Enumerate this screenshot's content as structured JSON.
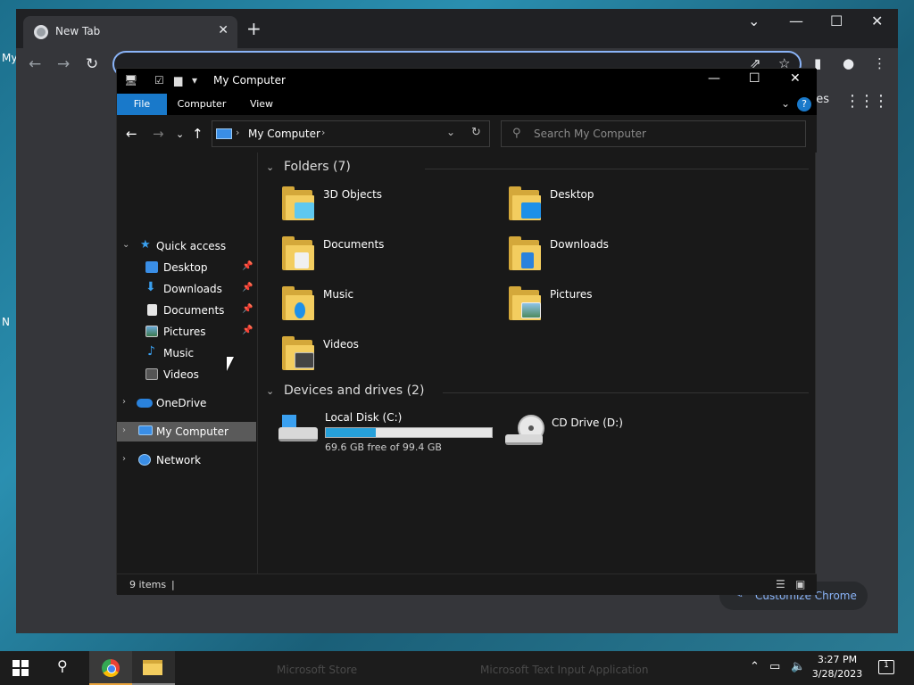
{
  "desktop": {
    "label_1": "My",
    "label_2": "N"
  },
  "chrome": {
    "tab_title": "New Tab",
    "images_link": "ages",
    "customize_label": "Customize Chrome"
  },
  "explorer": {
    "title": "My Computer",
    "ribbon_tabs": [
      "File",
      "Computer",
      "View"
    ],
    "breadcrumb": "My Computer",
    "search_placeholder": "Search My Computer",
    "nav": {
      "quick_access": "Quick access",
      "quick_items": [
        "Desktop",
        "Downloads",
        "Documents",
        "Pictures",
        "Music",
        "Videos"
      ],
      "onedrive": "OneDrive",
      "my_computer": "My Computer",
      "network": "Network"
    },
    "folders_header": "Folders (7)",
    "folders": [
      "3D Objects",
      "Desktop",
      "Documents",
      "Downloads",
      "Music",
      "Pictures",
      "Videos"
    ],
    "drives_header": "Devices and drives (2)",
    "drives": [
      {
        "name": "Local Disk (C:)",
        "free_text": "69.6 GB free of 99.4 GB",
        "used_fraction": 0.3
      },
      {
        "name": "CD Drive (D:)"
      }
    ],
    "status_items": "9 items",
    "status_sep": "|"
  },
  "taskbar": {
    "faded_items": [
      "Microsoft Store",
      "Microsoft Text Input Application"
    ],
    "time": "3:27 PM",
    "date": "3/28/2023",
    "notification_count": "1"
  },
  "colors": {
    "accent": "#1979ca",
    "folder": "#f3cd5f",
    "drive_fill": "#26a0da",
    "chrome_link": "#8ab4f8"
  }
}
